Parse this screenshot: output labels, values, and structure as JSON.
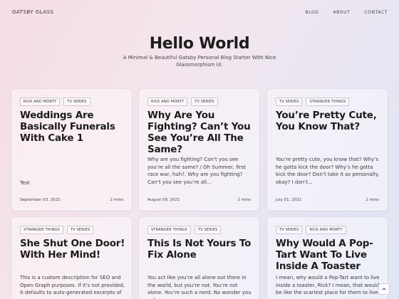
{
  "nav": {
    "brand": "GATSBY GLASS",
    "links": [
      "BLOG",
      "ABOUT",
      "CONTACT"
    ]
  },
  "hero": {
    "title": "Hello World",
    "subtitle": "A Minimal & Beautiful Gatsby Personal Blog Starter With Nice Glassmorphism UI."
  },
  "posts": [
    {
      "tags": [
        "RICK AND MORTY",
        "TV SERIES"
      ],
      "title": "Weddings Are Basically Funerals With Cake 1",
      "description": "Test",
      "date": "September 03, 2021",
      "read_time": "2 mins"
    },
    {
      "tags": [
        "RICK AND MORTY",
        "TV SERIES"
      ],
      "title": "Why Are You Fighting? Can’t You See You’re All The Same?",
      "description": "Why are you fighting? Can’t you see you’re all the same? / Oh Summer, first race war, huh?. Why are you fighting? Can’t you see you’re all...",
      "date": "August 09, 2021",
      "read_time": "2 mins"
    },
    {
      "tags": [
        "TV SERIES",
        "STRANGER THINGS"
      ],
      "title": "You’re Pretty Cute, You Know That?",
      "description": "You’re pretty cute, you know that? Why’s he gotta kick the door? Why’s he gotta kick the door? Don’t take it so personally, okay? I don’t...",
      "date": "July 01, 2021",
      "read_time": "2 mins"
    },
    {
      "tags": [
        "STRANGER THINGS",
        "TV SERIES"
      ],
      "title": "She Shut One Door! With Her Mind!",
      "description": "This is a custom description for SEO and Open Graph purposes. If it's not provided, it defaults to auto-generated excerpts of",
      "date": "",
      "read_time": ""
    },
    {
      "tags": [
        "STRANGER THINGS",
        "TV SERIES"
      ],
      "title": "This Is Not Yours To Fix Alone",
      "description": "You act like you’re all alone out there in the world, but you’re not. You’re not alone. You’re such a nerd. No wonder you only",
      "date": "",
      "read_time": ""
    },
    {
      "tags": [
        "TV SERIES",
        "RICK AND MORTY"
      ],
      "title": "Why Would A Pop-Tart Want To Live Inside A Toaster",
      "description": "I mean, why would a Pop-Tart want to live inside a toaster, Rick? I mean, that would be like the scariest place for them to live.",
      "date": "",
      "read_time": ""
    }
  ]
}
